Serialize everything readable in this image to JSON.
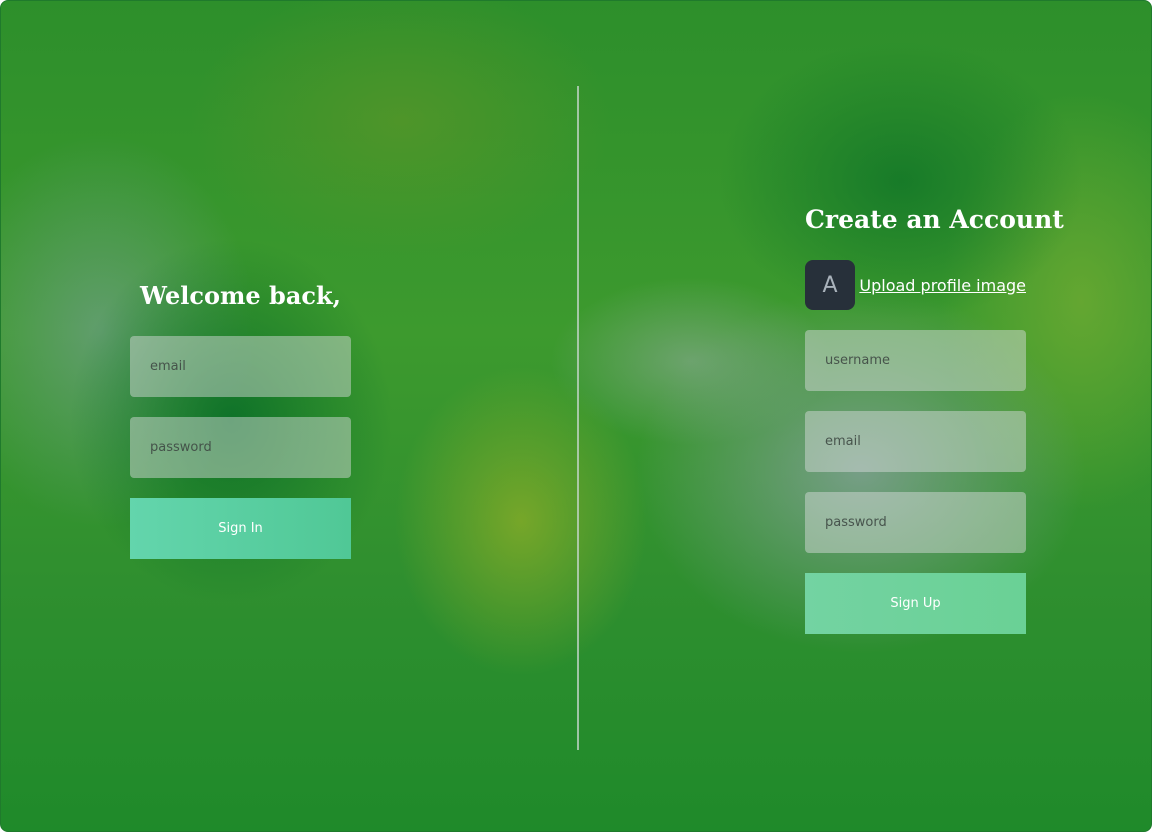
{
  "login": {
    "title": "Welcome back,",
    "email_placeholder": "email",
    "password_placeholder": "password",
    "submit_label": "Sign In"
  },
  "signup": {
    "title": "Create an Account",
    "avatar_letter": "A",
    "upload_label": "Upload profile image",
    "username_placeholder": "username",
    "email_placeholder": "email",
    "password_placeholder": "password",
    "submit_label": "Sign Up"
  },
  "colors": {
    "signin_button": "#55cc9c",
    "signup_button": "#6fd29c",
    "avatar_bg": "#27303a"
  }
}
